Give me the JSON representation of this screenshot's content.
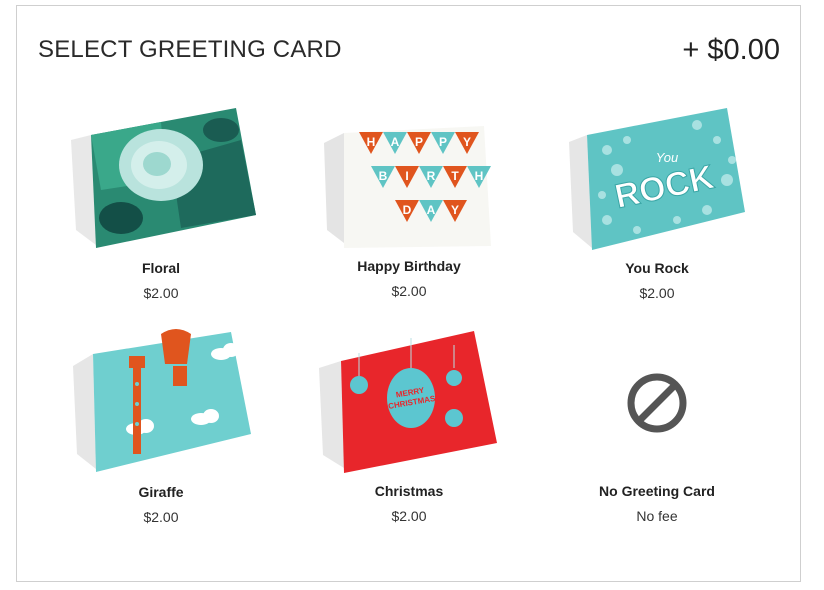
{
  "header": {
    "title": "SELECT GREETING CARD",
    "total": "+ $0.00"
  },
  "cards": [
    {
      "name": "Floral",
      "price": "$2.00"
    },
    {
      "name": "Happy Birthday",
      "price": "$2.00",
      "art_text": [
        "H",
        "A",
        "P",
        "P",
        "Y",
        "B",
        "I",
        "R",
        "T",
        "H",
        "D",
        "A",
        "Y"
      ]
    },
    {
      "name": "You Rock",
      "price": "$2.00",
      "art_text": "ROCK",
      "art_small": "You"
    },
    {
      "name": "Giraffe",
      "price": "$2.00"
    },
    {
      "name": "Christmas",
      "price": "$2.00",
      "art_text": [
        "MERRY",
        "CHRISTMAS"
      ]
    },
    {
      "name": "No Greeting Card",
      "price": "No fee",
      "icon": "no-symbol-icon"
    }
  ],
  "colors": {
    "teal": "#5fc4c4",
    "orange": "#e0551e",
    "red": "#e8262b",
    "icon": "#555555"
  }
}
